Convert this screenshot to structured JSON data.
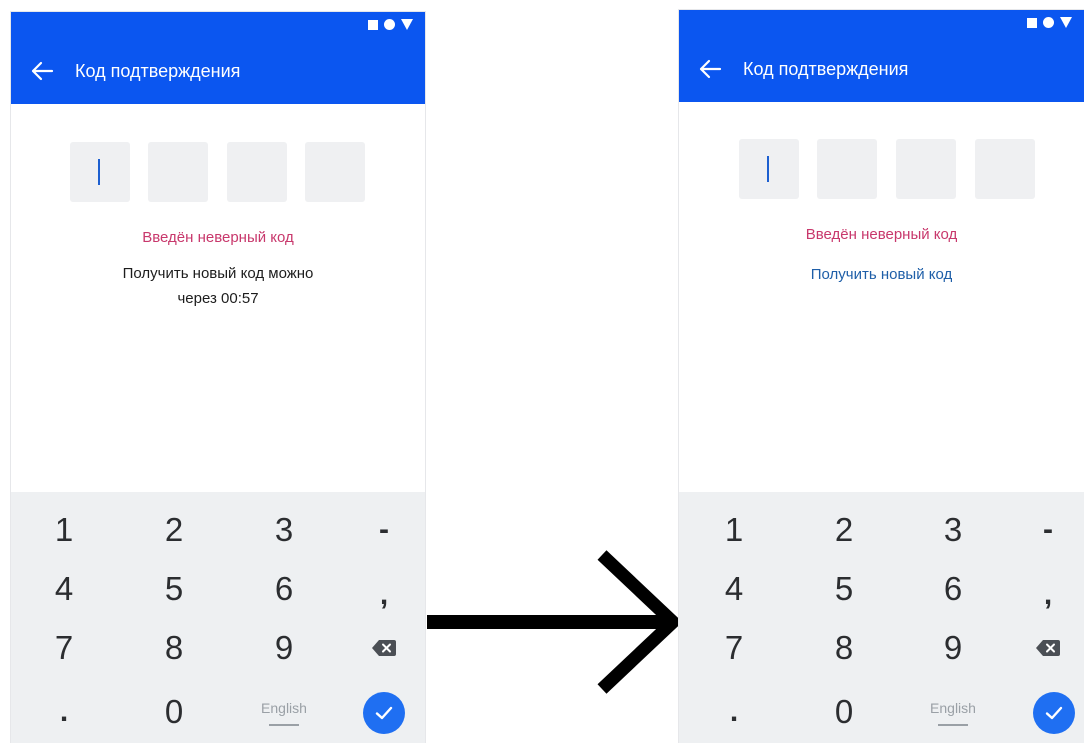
{
  "colors": {
    "primary": "#0b56f0",
    "error": "#c8386c",
    "link": "#1f5fa8",
    "keyboard_bg": "#eef0f2",
    "code_box_bg": "#eff0f2",
    "enter_button": "#1f6ff2"
  },
  "icons": {
    "status": [
      "square-icon",
      "circle-icon",
      "triangle-icon"
    ],
    "back": "arrow-left-icon",
    "backspace": "backspace-icon",
    "enter": "check-icon",
    "transition": "arrow-right-icon"
  },
  "left_screen": {
    "title": "Код подтверждения",
    "error": "Введён неверный код",
    "info_line1": "Получить новый код можно",
    "info_line2": "через 00:57"
  },
  "right_screen": {
    "title": "Код подтверждения",
    "error": "Введён неверный код",
    "resend_link": "Получить новый код"
  },
  "keyboard": {
    "keys": [
      "1",
      "2",
      "3",
      "-",
      "4",
      "5",
      "6",
      ",",
      "7",
      "8",
      "9",
      ".",
      "0"
    ],
    "language": "English"
  }
}
